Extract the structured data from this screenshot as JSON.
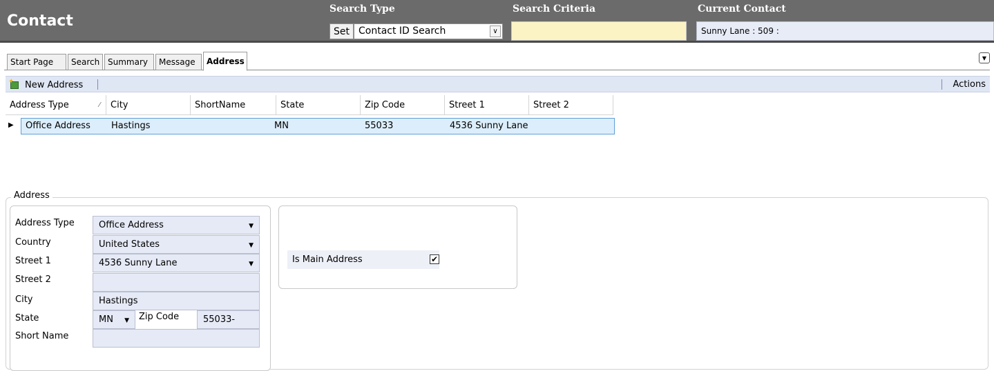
{
  "header": {
    "title": "Contact",
    "search_type_label": "Search Type",
    "search_criteria_label": "Search Criteria",
    "current_contact_label": "Current Contact",
    "set_button": "Set",
    "search_type_value": "Contact ID Search",
    "search_criteria_value": "",
    "current_contact_value": "Sunny Lane : 509 :"
  },
  "tabs": [
    {
      "label": "Start Page"
    },
    {
      "label": "Search"
    },
    {
      "label": "Summary"
    },
    {
      "label": "Message"
    },
    {
      "label": "Address",
      "active": true
    }
  ],
  "toolbar": {
    "new_address": "New Address",
    "actions": "Actions"
  },
  "grid": {
    "columns": [
      "Address Type",
      "City",
      "ShortName",
      "State",
      "Zip Code",
      "Street 1",
      "Street 2"
    ],
    "rows": [
      {
        "address_type": "Office Address",
        "city": "Hastings",
        "short_name": "",
        "state": "MN",
        "zip": "55033",
        "street1": "4536 Sunny Lane",
        "street2": ""
      }
    ]
  },
  "address": {
    "legend": "Address",
    "address_type_label": "Address Type",
    "address_type_value": "Office Address",
    "country_label": "Country",
    "country_value": "United States",
    "street1_label": "Street 1",
    "street1_value": "4536 Sunny Lane",
    "street2_label": "Street 2",
    "street2_value": "",
    "city_label": "City",
    "city_value": "Hastings",
    "state_label": "State",
    "state_value": "MN",
    "zip_label": "Zip Code",
    "zip_value": "55033-",
    "short_name_label": "Short Name",
    "short_name_value": "",
    "is_main_label": "Is Main Address",
    "is_main_checked": "✔"
  },
  "colors": {
    "header_bg": "#6b6b6b",
    "toolbar_bg": "#dfe6f4",
    "selected_row": "#dceefb",
    "field_bg": "#e6eaf6",
    "criteria_bg": "#fbf3c4"
  }
}
